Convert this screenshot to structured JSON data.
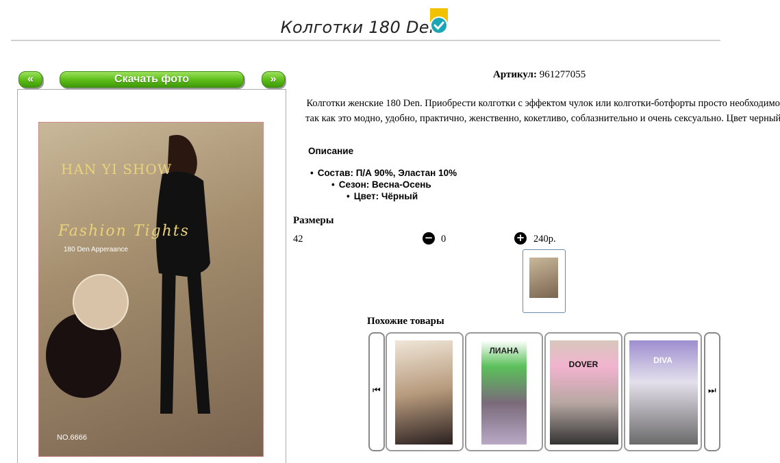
{
  "header": {
    "title": "Колготки 180 Den",
    "badge_icon": "check-badge-icon"
  },
  "gallery": {
    "prev_label": "«",
    "download_label": "Скачать фото",
    "next_label": "»",
    "photo": {
      "brand": "HAN YI SHOW",
      "script": "Fashion Tights",
      "subtitle": "180 Den Apperaance",
      "model_no": "NO.6666"
    }
  },
  "product": {
    "article_label": "Артикул:",
    "article_value": "961277055",
    "description": "Колготки женские 180 Den. Приобрести колготки с эффектом чулок или колготки-ботфорты просто необходимо, так как это модно, удобно, практично, женственно, кокетливо, соблазнительно и очень сексуально. Цвет черный.",
    "description_heading": "Описание",
    "properties": [
      "Состав: П/А 90%, Эластан 10%",
      "Сезон: Весна-Осень",
      "Цвет: Чёрный"
    ],
    "sizes_heading": "Размеры",
    "size": "42",
    "quantity": "0",
    "price": "240р."
  },
  "similar": {
    "heading": "Похожие товары",
    "items": [
      {
        "label": "",
        "icon": "product-image"
      },
      {
        "label": "ЛИАНА",
        "icon": "product-image"
      },
      {
        "label": "DOVER",
        "icon": "product-image"
      },
      {
        "label": "DIVA",
        "icon": "product-image"
      }
    ]
  },
  "colors": {
    "accent_green": "#5fbf1a",
    "badge_yellow": "#f2c200",
    "badge_teal": "#1aa6b7"
  }
}
